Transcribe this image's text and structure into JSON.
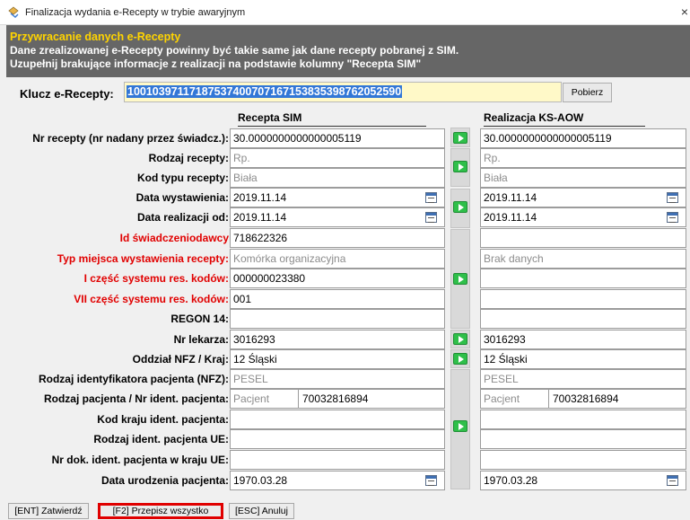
{
  "window": {
    "title": "Finalizacja wydania e-Recepty w trybie awaryjnym",
    "close": "×"
  },
  "header": {
    "title": "Przywracanie danych e-Recepty",
    "line1": "Dane zrealizowanej e-Recepty powinny być takie same jak dane recepty pobranej z SIM.",
    "line2": "Uzupełnij brakujące informacje z realizacji na podstawie kolumny \"Recepta SIM\""
  },
  "key": {
    "label": "Klucz e-Recepty:",
    "value": "10010397117187537400707167153835398762052590",
    "button": "Pobierz"
  },
  "columns": {
    "sim": "Recepta SIM",
    "ks": "Realizacja KS-AOW"
  },
  "rows": [
    {
      "label": "Nr recepty (nr nadany przez świadcz.):",
      "red": false,
      "sim": "30.0000000000000005119",
      "ks": "30.0000000000000005119"
    },
    {
      "label": "Rodzaj recepty:",
      "red": false,
      "sim": "Rp.",
      "ks": "Rp."
    },
    {
      "label": "Kod typu recepty:",
      "red": false,
      "sim": "Biała",
      "ks": "Biała"
    },
    {
      "label": "Data wystawienia:",
      "red": false,
      "sim": "2019.11.14",
      "ks": "2019.11.14"
    },
    {
      "label": "Data realizacji od:",
      "red": false,
      "sim": "2019.11.14",
      "ks": "2019.11.14"
    },
    {
      "label": "Id świadczeniodawcy",
      "red": true,
      "sim": "718622326",
      "ks": ""
    },
    {
      "label": "Typ miejsca wystawienia recepty:",
      "red": true,
      "sim": "Komórka organizacyjna",
      "ks": "Brak danych"
    },
    {
      "label": "I część systemu res. kodów:",
      "red": true,
      "sim": "000000023380",
      "ks": ""
    },
    {
      "label": "VII część systemu res. kodów:",
      "red": true,
      "sim": "001",
      "ks": ""
    },
    {
      "label": "REGON 14:",
      "red": false,
      "sim": "",
      "ks": ""
    },
    {
      "label": "Nr lekarza:",
      "red": false,
      "sim": "3016293",
      "ks": "3016293"
    },
    {
      "label": "Oddział NFZ / Kraj:",
      "red": false,
      "sim": "12 Śląski",
      "ks": "12 Śląski"
    },
    {
      "label": "Rodzaj identyfikatora pacjenta (NFZ):",
      "red": false,
      "sim": "PESEL",
      "ks": "PESEL"
    },
    {
      "label": "Rodzaj pacjenta / Nr ident. pacjenta:",
      "red": false,
      "sim": "Pacjent",
      "sim2": "70032816894",
      "ks": "Pacjent",
      "ks2": "70032816894"
    },
    {
      "label": "Kod kraju ident. pacjenta:",
      "red": false,
      "sim": "",
      "ks": ""
    },
    {
      "label": "Rodzaj  ident. pacjenta UE:",
      "red": false,
      "sim": "",
      "ks": ""
    },
    {
      "label": "Nr dok. ident. pacjenta w kraju UE:",
      "red": false,
      "sim": "",
      "ks": ""
    },
    {
      "label": "Data urodzenia pacjenta:",
      "red": false,
      "sim": "1970.03.28",
      "ks": "1970.03.28"
    }
  ],
  "footer": {
    "confirm": "[ENT] Zatwierdź",
    "copy_all": "[F2] Przepisz wszystko",
    "cancel": "[ESC] Anuluj"
  },
  "colors": {
    "header_bg": "#666666",
    "header_title": "#ffd400",
    "required_label": "#e10000",
    "key_bg": "#fff9c8",
    "key_selection": "#3277d7",
    "copy_button": "#2fbf4a",
    "highlight_border": "#e00000"
  },
  "icons": {
    "app": "app-icon",
    "calendar": "calendar-icon",
    "copy": "copy-arrow-icon"
  }
}
